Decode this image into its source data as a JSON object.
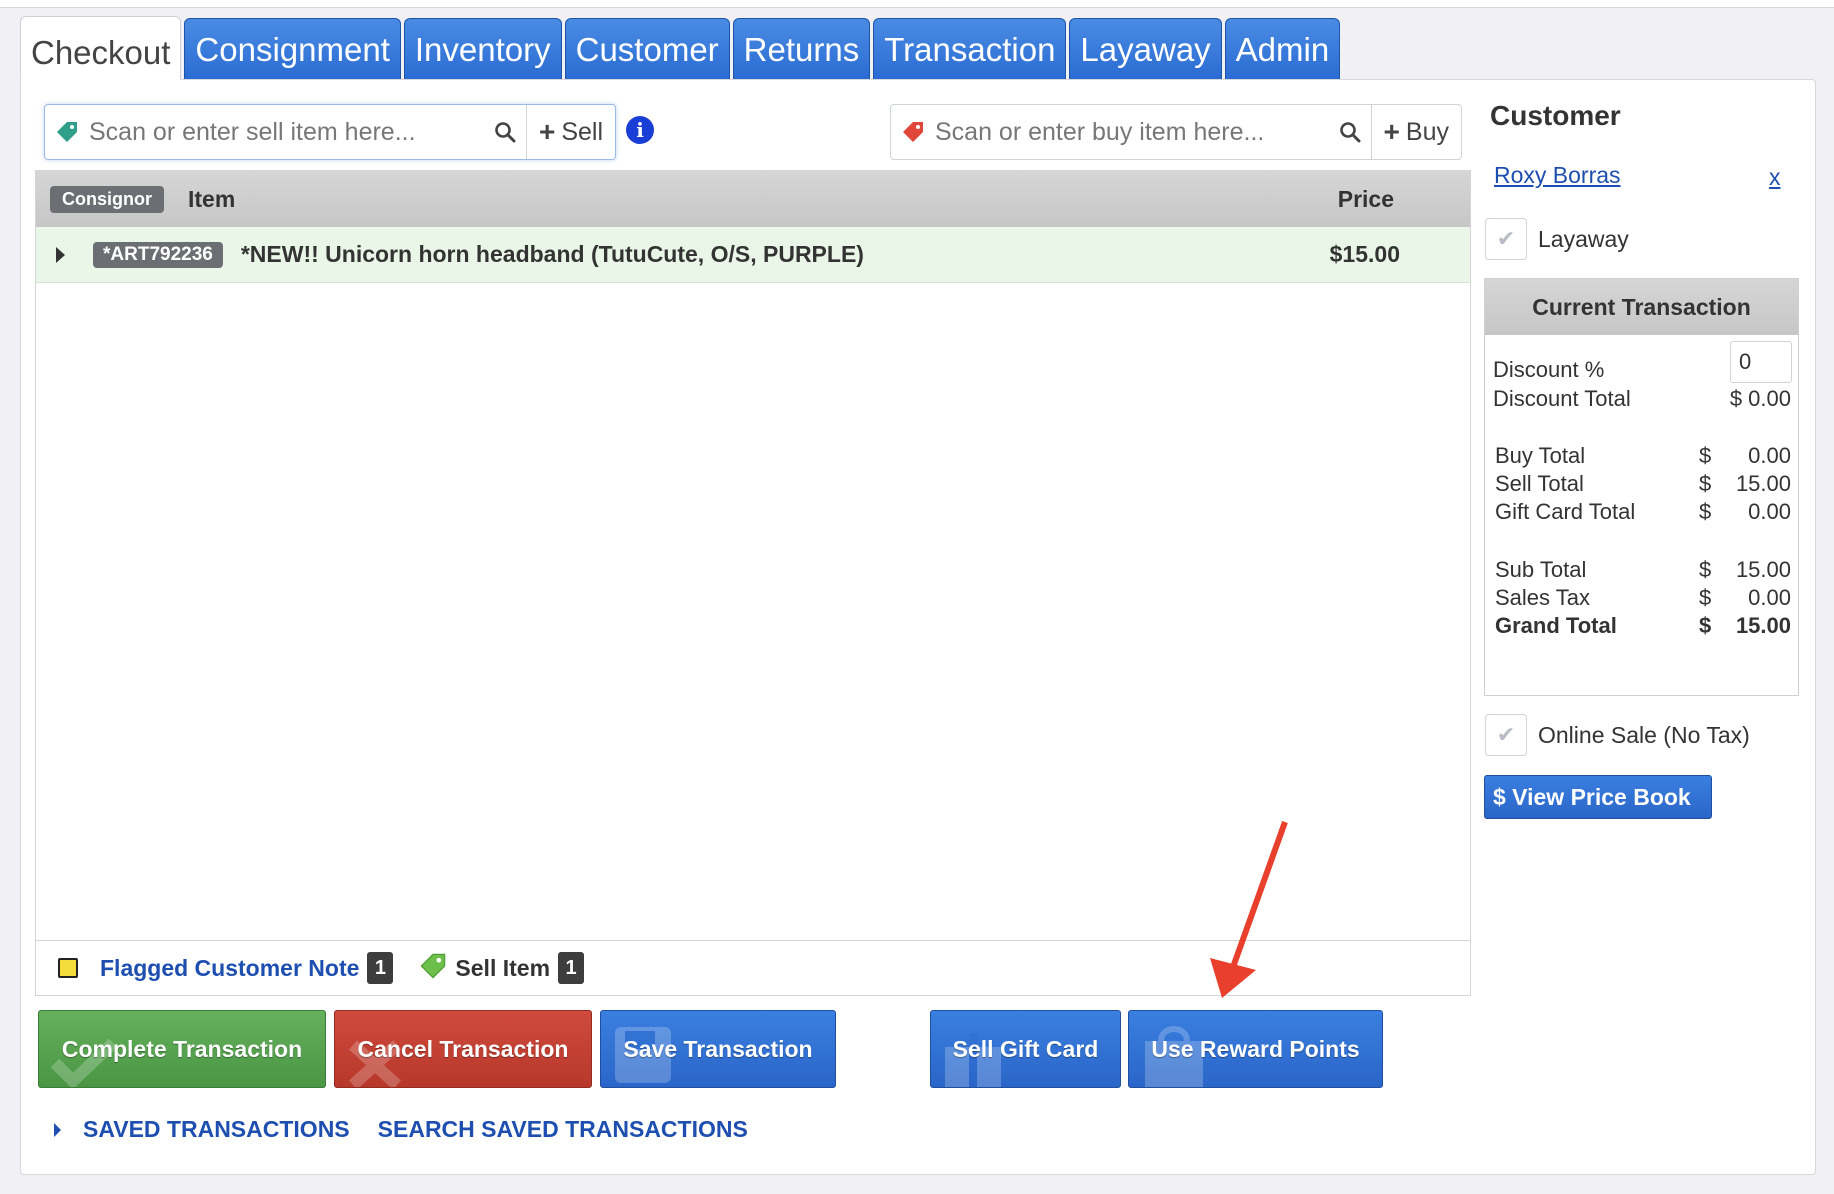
{
  "tabs": [
    "Checkout",
    "Consignment",
    "Inventory",
    "Customer",
    "Returns",
    "Transaction",
    "Layaway",
    "Admin"
  ],
  "sell_scan": {
    "placeholder": "Scan or enter sell item here...",
    "button": "Sell"
  },
  "buy_scan": {
    "placeholder": "Scan or enter buy item here...",
    "button": "Buy"
  },
  "table": {
    "headers": {
      "consignor": "Consignor",
      "item": "Item",
      "price": "Price"
    },
    "rows": [
      {
        "sku": "*ART792236",
        "description": "*NEW!! Unicorn horn headband (TutuCute, O/S, PURPLE)",
        "price": "$15.00"
      }
    ]
  },
  "footer_notes": {
    "flagged_label": "Flagged Customer Note",
    "flagged_count": "1",
    "sell_label": "Sell Item",
    "sell_count": "1"
  },
  "actions": {
    "complete": "Complete Transaction",
    "cancel": "Cancel Transaction",
    "save": "Save Transaction",
    "gift_card": "Sell Gift Card",
    "reward": "Use Reward Points"
  },
  "links": {
    "saved": "SAVED TRANSACTIONS",
    "search_saved": "SEARCH SAVED TRANSACTIONS"
  },
  "customer": {
    "title": "Customer",
    "name": "Roxy Borras",
    "remove": "x",
    "layaway_label": "Layaway",
    "online_label": "Online Sale (No Tax)",
    "price_book": "$ View Price Book"
  },
  "current_transaction": {
    "title": "Current Transaction",
    "discount_pct_label": "Discount %",
    "discount_pct_value": "0",
    "discount_total_label": "Discount Total",
    "discount_total_value": "$ 0.00",
    "currency": "$",
    "lines": [
      {
        "label": "Buy Total",
        "value": "0.00"
      },
      {
        "label": "Sell Total",
        "value": "15.00"
      },
      {
        "label": "Gift Card Total",
        "value": "0.00"
      },
      {
        "label": "Sub Total",
        "value": "15.00"
      },
      {
        "label": "Sales Tax",
        "value": "0.00"
      },
      {
        "label": "Grand Total",
        "value": "15.00"
      }
    ]
  },
  "colors": {
    "accent_blue": "#2a66c8",
    "complete_green": "#4a9644",
    "cancel_red": "#b7382b",
    "annotation_arrow": "#e8402c"
  }
}
